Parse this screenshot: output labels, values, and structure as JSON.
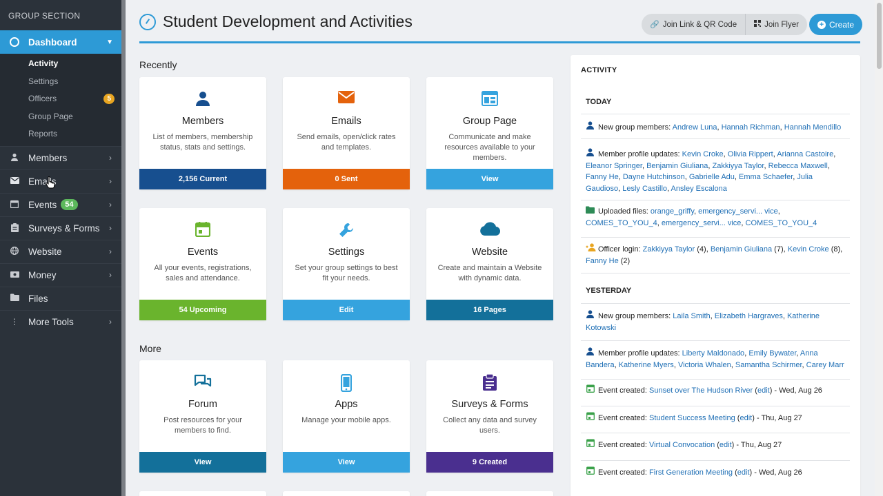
{
  "sidebar": {
    "group_label": "GROUP SECTION",
    "dashboard": {
      "label": "Dashboard",
      "icon": "dashboard-icon"
    },
    "subitems": [
      {
        "label": "Activity",
        "active": true
      },
      {
        "label": "Settings"
      },
      {
        "label": "Officers",
        "badge": "5"
      },
      {
        "label": "Group Page"
      },
      {
        "label": "Reports"
      }
    ],
    "items": [
      {
        "label": "Members",
        "icon": "person-icon"
      },
      {
        "label": "Emails",
        "icon": "envelope-icon"
      },
      {
        "label": "Events",
        "icon": "calendar-icon",
        "badge": "54"
      },
      {
        "label": "Surveys & Forms",
        "icon": "clipboard-icon"
      },
      {
        "label": "Website",
        "icon": "globe-icon"
      },
      {
        "label": "Money",
        "icon": "money-icon"
      },
      {
        "label": "Files",
        "icon": "folder-icon"
      },
      {
        "label": "More Tools",
        "icon": "more-icon"
      }
    ]
  },
  "header": {
    "title": "Student Development and Activities",
    "join_link_label": "Join Link & QR Code",
    "join_flyer_label": "Join Flyer",
    "create_label": "Create"
  },
  "sections": {
    "recently": "Recently",
    "more": "More"
  },
  "cards": [
    {
      "title": "Members",
      "desc": "List of members, membership status, stats and settings.",
      "action": "2,156 Current",
      "color": "#174f8f",
      "icon": "person-icon",
      "icon_color": "#174f8f"
    },
    {
      "title": "Emails",
      "desc": "Send emails, open/click rates and templates.",
      "action": "0 Sent",
      "color": "#e4620c",
      "icon": "envelope-icon",
      "icon_color": "#e4620c"
    },
    {
      "title": "Group Page",
      "desc": "Communicate and make resources available to your members.",
      "action": "View",
      "color": "#35a3de",
      "icon": "webpage-icon",
      "icon_color": "#35a3de"
    },
    {
      "title": "Events",
      "desc": "All your events, registrations, sales and attendance.",
      "action": "54 Upcoming",
      "color": "#6ab42d",
      "icon": "calendar-icon",
      "icon_color": "#6ab42d"
    },
    {
      "title": "Settings",
      "desc": "Set your group settings to best fit your needs.",
      "action": "Edit",
      "color": "#35a3de",
      "icon": "wrench-icon",
      "icon_color": "#35a3de"
    },
    {
      "title": "Website",
      "desc": "Create and maintain a Website with dynamic data.",
      "action": "16 Pages",
      "color": "#13709a",
      "icon": "cloud-icon",
      "icon_color": "#13709a"
    },
    {
      "title": "Forum",
      "desc": "Post resources for your members to find.",
      "action": "View",
      "color": "#13709a",
      "icon": "chat-icon",
      "icon_color": "#13709a"
    },
    {
      "title": "Apps",
      "desc": "Manage your mobile apps.",
      "action": "View",
      "color": "#35a3de",
      "icon": "phone-icon",
      "icon_color": "#35a3de"
    },
    {
      "title": "Surveys & Forms",
      "desc": "Collect any data and survey users.",
      "action": "9 Created",
      "color": "#4a2f8f",
      "icon": "clipboard-icon",
      "icon_color": "#4a2f8f"
    }
  ],
  "activity": {
    "title": "ACTIVITY",
    "today": "TODAY",
    "yesterday": "YESTERDAY",
    "entries": [
      {
        "icon": "person-icon",
        "parts": [
          {
            "t": "New group members: "
          },
          {
            "t": "Andrew Luna",
            "link": true
          },
          {
            "t": ", "
          },
          {
            "t": "Hannah Richman",
            "link": true
          },
          {
            "t": ", "
          },
          {
            "t": "Hannah Mendillo",
            "link": true
          }
        ]
      },
      {
        "icon": "person-icon",
        "parts": [
          {
            "t": "Member profile updates: "
          },
          {
            "t": "Kevin Croke",
            "link": true
          },
          {
            "t": ", "
          },
          {
            "t": "Olivia Rippert",
            "link": true
          },
          {
            "t": ", "
          },
          {
            "t": "Arianna Castoire",
            "link": true
          },
          {
            "t": ", "
          },
          {
            "t": "Eleanor Springer",
            "link": true
          },
          {
            "t": ", "
          },
          {
            "t": "Benjamin Giuliana",
            "link": true
          },
          {
            "t": ", "
          },
          {
            "t": "Zakkiyya Taylor",
            "link": true
          },
          {
            "t": ", "
          },
          {
            "t": "Rebecca Maxwell",
            "link": true
          },
          {
            "t": ", "
          },
          {
            "t": "Fanny He",
            "link": true
          },
          {
            "t": ", "
          },
          {
            "t": "Dayne Hutchinson",
            "link": true
          },
          {
            "t": ", "
          },
          {
            "t": "Gabrielle Adu",
            "link": true
          },
          {
            "t": ", "
          },
          {
            "t": "Emma Schaefer",
            "link": true
          },
          {
            "t": ", "
          },
          {
            "t": "Julia Gaudioso",
            "link": true
          },
          {
            "t": ", "
          },
          {
            "t": "Lesly Castillo",
            "link": true
          },
          {
            "t": ", "
          },
          {
            "t": "Ansley Escalona",
            "link": true
          }
        ]
      },
      {
        "icon": "folder-icon",
        "parts": [
          {
            "t": "Uploaded files: "
          },
          {
            "t": "orange_griffy",
            "link": true
          },
          {
            "t": ", "
          },
          {
            "t": "emergency_servi... vice",
            "link": true
          },
          {
            "t": ", "
          },
          {
            "t": "COMES_TO_YOU_4",
            "link": true
          },
          {
            "t": ", "
          },
          {
            "t": "emergency_servi... vice",
            "link": true
          },
          {
            "t": ", "
          },
          {
            "t": "COMES_TO_YOU_4",
            "link": true
          }
        ]
      },
      {
        "icon": "officer-icon",
        "parts": [
          {
            "t": "Officer login: "
          },
          {
            "t": "Zakkiyya Taylor",
            "link": true
          },
          {
            "t": " (4), "
          },
          {
            "t": "Benjamin Giuliana",
            "link": true
          },
          {
            "t": " (7), "
          },
          {
            "t": "Kevin Croke",
            "link": true
          },
          {
            "t": " (8), "
          },
          {
            "t": "Fanny He",
            "link": true
          },
          {
            "t": " (2)"
          }
        ]
      },
      {
        "icon": "person-icon",
        "parts": [
          {
            "t": "New group members: "
          },
          {
            "t": "Laila Smith",
            "link": true
          },
          {
            "t": ", "
          },
          {
            "t": "Elizabeth Hargraves",
            "link": true
          },
          {
            "t": ", "
          },
          {
            "t": "Katherine Kotowski",
            "link": true
          }
        ]
      },
      {
        "icon": "person-icon",
        "parts": [
          {
            "t": "Member profile updates: "
          },
          {
            "t": "Liberty Maldonado",
            "link": true
          },
          {
            "t": ", "
          },
          {
            "t": "Emily Bywater",
            "link": true
          },
          {
            "t": ", "
          },
          {
            "t": "Anna Bandera",
            "link": true
          },
          {
            "t": ", "
          },
          {
            "t": "Katherine Myers",
            "link": true
          },
          {
            "t": ", "
          },
          {
            "t": "Victoria Whalen",
            "link": true
          },
          {
            "t": ", "
          },
          {
            "t": "Samantha Schirmer",
            "link": true
          },
          {
            "t": ", "
          },
          {
            "t": "Carey Marr",
            "link": true
          }
        ]
      },
      {
        "icon": "calendar-icon",
        "parts": [
          {
            "t": "Event created: "
          },
          {
            "t": "Sunset over The Hudson River",
            "link": true
          },
          {
            "t": " ("
          },
          {
            "t": "edit",
            "link": true
          },
          {
            "t": ") - Wed, Aug 26"
          }
        ]
      },
      {
        "icon": "calendar-icon",
        "parts": [
          {
            "t": "Event created: "
          },
          {
            "t": "Student Success Meeting",
            "link": true
          },
          {
            "t": " ("
          },
          {
            "t": "edit",
            "link": true
          },
          {
            "t": ") - Thu, Aug 27"
          }
        ]
      },
      {
        "icon": "calendar-icon",
        "parts": [
          {
            "t": "Event created: "
          },
          {
            "t": "Virtual Convocation",
            "link": true
          },
          {
            "t": " ("
          },
          {
            "t": "edit",
            "link": true
          },
          {
            "t": ") - Thu, Aug 27"
          }
        ]
      },
      {
        "icon": "calendar-icon",
        "parts": [
          {
            "t": "Event created: "
          },
          {
            "t": "First Generation Meeting",
            "link": true
          },
          {
            "t": " ("
          },
          {
            "t": "edit",
            "link": true
          },
          {
            "t": ") - Wed, Aug 26"
          }
        ]
      }
    ]
  },
  "colors": {
    "accent": "#2d9ad6",
    "sidebar_bg": "#2b323a",
    "link": "#1f6fb5"
  }
}
